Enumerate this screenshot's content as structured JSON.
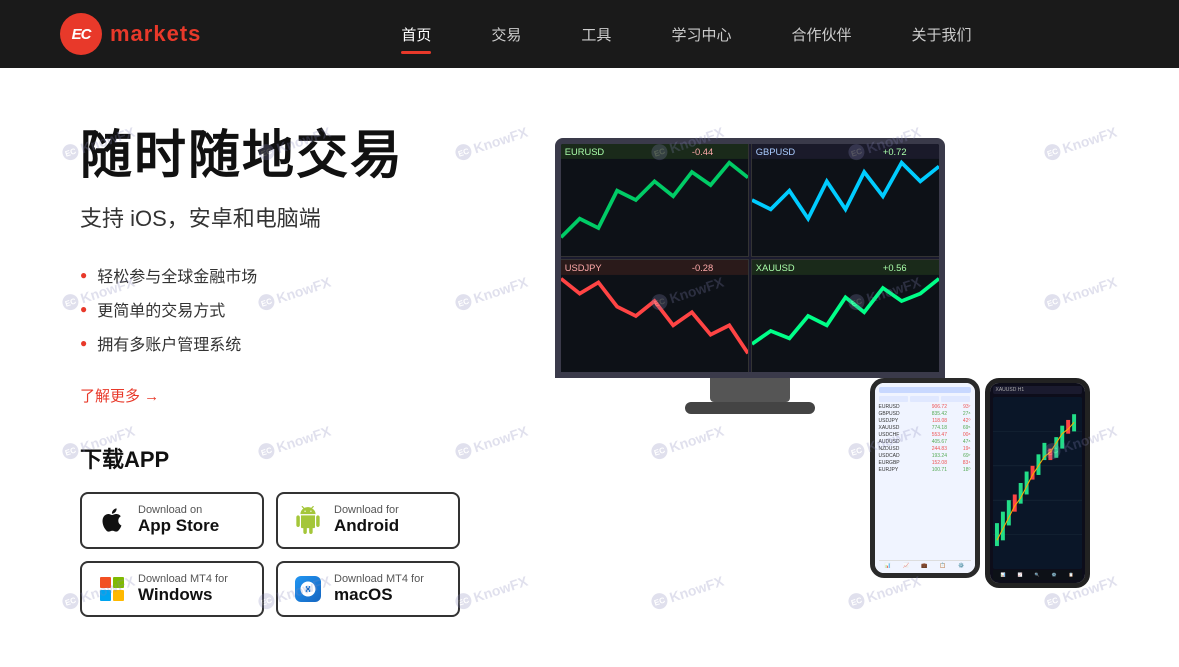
{
  "header": {
    "logo_text_ec": "EC",
    "logo_text_markets": "markets",
    "nav": [
      {
        "label": "首页",
        "active": true,
        "id": "nav-home"
      },
      {
        "label": "交易",
        "active": false,
        "id": "nav-trade"
      },
      {
        "label": "工具",
        "active": false,
        "id": "nav-tools"
      },
      {
        "label": "学习中心",
        "active": false,
        "id": "nav-learn"
      },
      {
        "label": "合作伙伴",
        "active": false,
        "id": "nav-partner"
      },
      {
        "label": "关于我们",
        "active": false,
        "id": "nav-about"
      }
    ]
  },
  "hero": {
    "title": "随时随地交易",
    "subtitle": "支持 iOS，安卓和电脑端",
    "features": [
      "轻松参与全球金融市场",
      "更简单的交易方式",
      "拥有多账户管理系统"
    ],
    "learn_more": "了解更多 →"
  },
  "download": {
    "title": "下载APP",
    "buttons": [
      {
        "id": "btn-appstore",
        "small": "Download on",
        "big": "App Store",
        "icon": "apple"
      },
      {
        "id": "btn-android",
        "small": "Download for",
        "big": "Android",
        "icon": "android"
      },
      {
        "id": "btn-windows",
        "small": "Download MT4 for",
        "big": "Windows",
        "icon": "windows"
      },
      {
        "id": "btn-macos",
        "small": "Download MT4 for",
        "big": "macOS",
        "icon": "macos"
      }
    ]
  },
  "watermark": {
    "text": "KnowFX",
    "symbol": "EC"
  }
}
